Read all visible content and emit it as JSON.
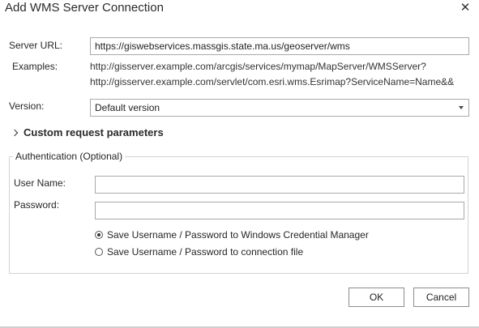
{
  "dialog": {
    "title": "Add WMS Server Connection",
    "close_icon": "close-icon"
  },
  "server": {
    "label": "Server URL:",
    "value": "https://giswebservices.massgis.state.ma.us/geoserver/wms"
  },
  "examples": {
    "label": "Examples:",
    "lines": [
      "http://gisserver.example.com/arcgis/services/mymap/MapServer/WMSServer?",
      "http://gisserver.example.com/servlet/com.esri.wms.Esrimap?ServiceName=Name&&"
    ]
  },
  "version": {
    "label": "Version:",
    "selected": "Default version"
  },
  "custom_params": {
    "label": "Custom request parameters"
  },
  "auth": {
    "group_title": "Authentication (Optional)",
    "username_label": "User Name:",
    "username_value": "",
    "password_label": "Password:",
    "password_value": "",
    "options": [
      {
        "label": "Save Username / Password to Windows Credential Manager",
        "checked": true
      },
      {
        "label": "Save Username / Password to connection file",
        "checked": false
      }
    ]
  },
  "buttons": {
    "ok": "OK",
    "cancel": "Cancel"
  }
}
